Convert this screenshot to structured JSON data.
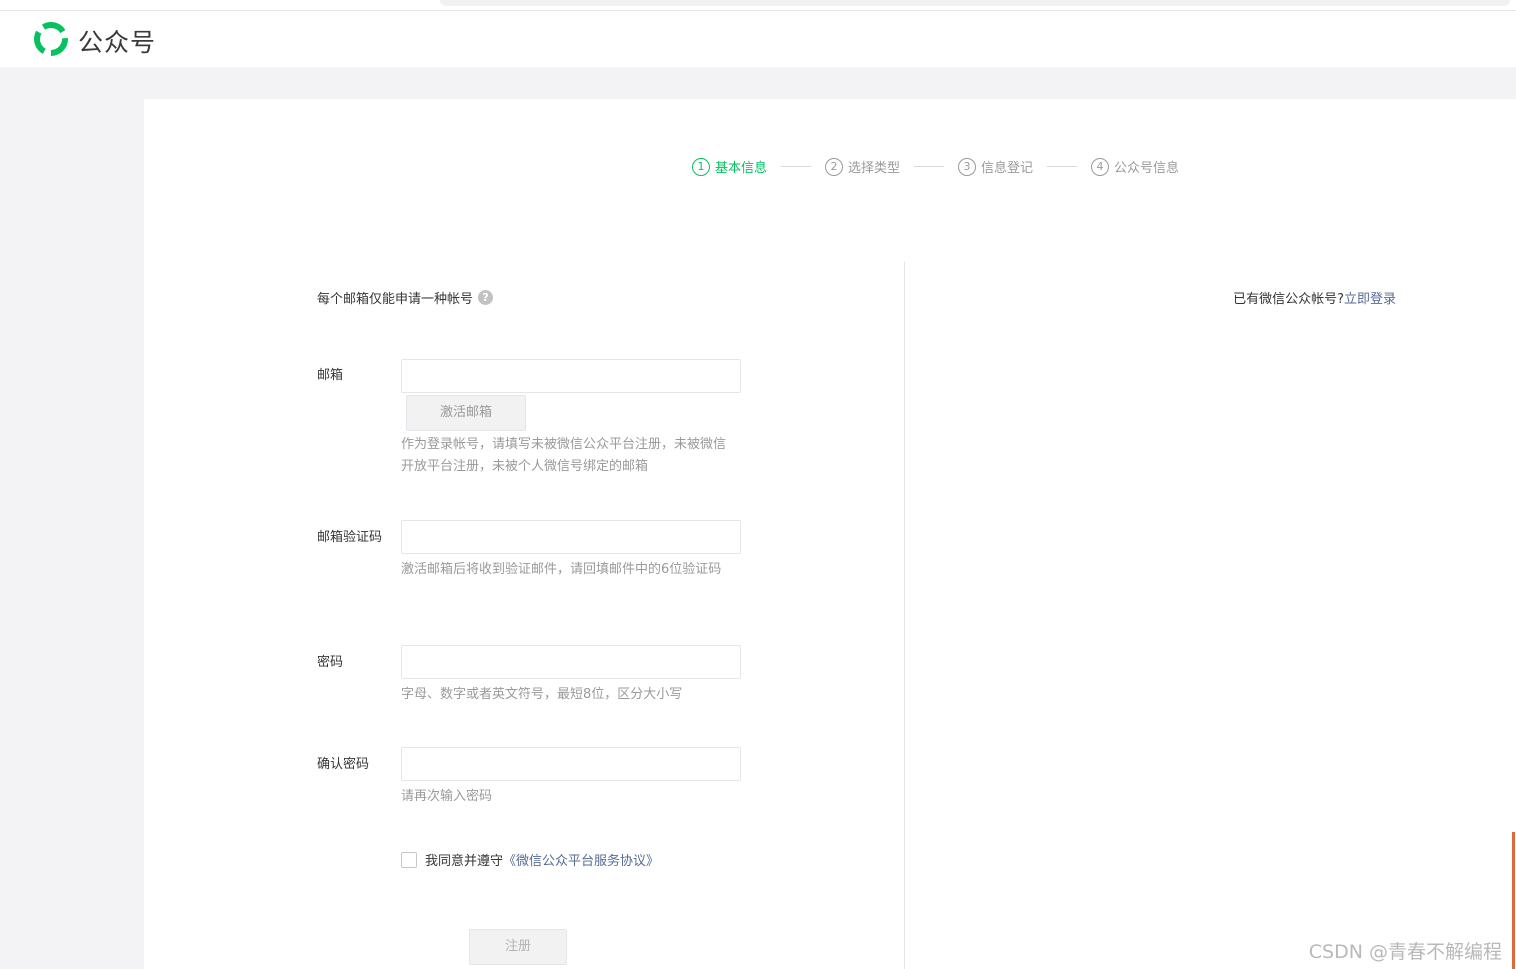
{
  "header": {
    "brand": "公众号"
  },
  "steps": [
    {
      "num": "1",
      "label": "基本信息",
      "active": true
    },
    {
      "num": "2",
      "label": "选择类型",
      "active": false
    },
    {
      "num": "3",
      "label": "信息登记",
      "active": false
    },
    {
      "num": "4",
      "label": "公众号信息",
      "active": false
    }
  ],
  "form": {
    "notice": "每个邮箱仅能申请一种帐号",
    "help_icon_glyph": "?",
    "login_prompt": "已有微信公众帐号?",
    "login_link": "立即登录",
    "email": {
      "label": "邮箱",
      "value": "",
      "activate_button": "激活邮箱",
      "hint": "作为登录帐号，请填写未被微信公众平台注册，未被微信开放平台注册，未被个人微信号绑定的邮箱"
    },
    "verify_code": {
      "label": "邮箱验证码",
      "value": "",
      "hint": "激活邮箱后将收到验证邮件，请回填邮件中的6位验证码"
    },
    "password": {
      "label": "密码",
      "value": "",
      "hint": "字母、数字或者英文符号，最短8位，区分大小写"
    },
    "confirm_password": {
      "label": "确认密码",
      "value": "",
      "hint": "请再次输入密码"
    },
    "agreement": {
      "text": "我同意并遵守",
      "link": "《微信公众平台服务协议》",
      "checked": false
    },
    "submit": "注册"
  },
  "watermark": "CSDN @青春不解编程",
  "colors": {
    "accent": "#07c160",
    "link": "#576b95",
    "hint": "#9a9a9a"
  }
}
